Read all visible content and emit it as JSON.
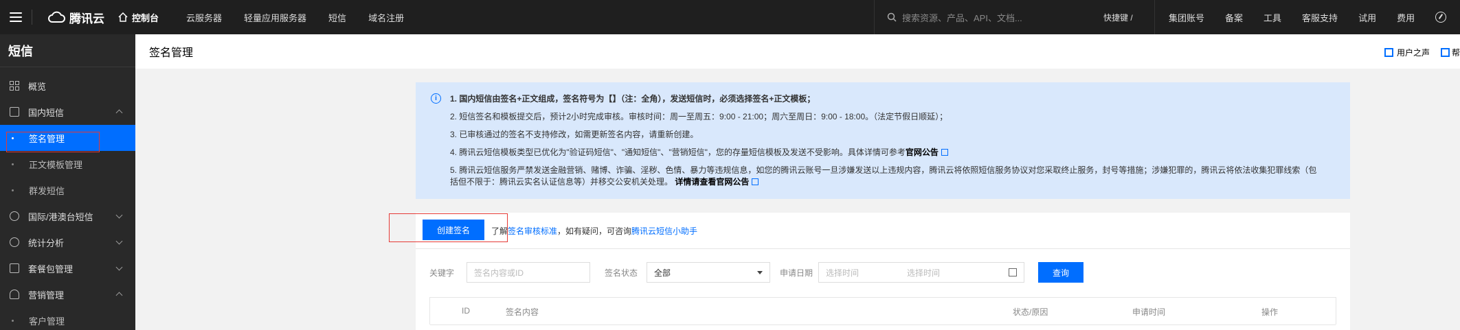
{
  "topbar": {
    "brand": "腾讯云",
    "console": "控制台",
    "nav": [
      "云服务器",
      "轻量应用服务器",
      "短信",
      "域名注册"
    ],
    "search_placeholder": "搜索资源、产品、API、文档...",
    "shortcut": "快捷键 /",
    "right_nav": [
      "集团账号",
      "备案",
      "工具",
      "客服支持",
      "试用",
      "费用"
    ]
  },
  "sidebar": {
    "title": "短信",
    "items": [
      {
        "label": "概览"
      },
      {
        "label": "国内短信"
      },
      {
        "label": "签名管理"
      },
      {
        "label": "正文模板管理"
      },
      {
        "label": "群发短信"
      },
      {
        "label": "国际/港澳台短信"
      },
      {
        "label": "统计分析"
      },
      {
        "label": "套餐包管理"
      },
      {
        "label": "营销管理"
      },
      {
        "label": "客户管理"
      }
    ]
  },
  "header": {
    "title": "签名管理",
    "user_voice": "用户之声",
    "doc": "帮"
  },
  "notice": {
    "items": [
      "1. 国内短信由签名+正文组成，签名符号为【】（注：全角），发送短信时，必须选择签名+正文模板；",
      "2. 短信签名和模板提交后，预计2小时完成审核。审核时间：周一至周五：9:00 - 21:00；周六至周日：9:00 - 18:00。（法定节假日顺延）；",
      "3. 已审核通过的签名不支持修改，如需更新签名内容，请重新创建。",
      "4. 腾讯云短信模板类型已优化为\"验证码短信\"、\"通知短信\"、\"营销短信\"，您的存量短信模板及发送不受影响。具体详情可参考",
      "5. 腾讯云短信服务严禁发送金融营销、赌博、诈骗、淫秽、色情、暴力等违规信息，如您的腾讯云账号一旦涉嫌发送以上违规内容，腾讯云将依照短信服务协议对您采取终止服务，封号等措施；涉嫌犯罪的，腾讯云将依法收集犯罪线索（包",
      "括但不限于：腾讯云实名认证信息等）并移交公安机关处理。"
    ],
    "link_official": "官网公告",
    "link_detail": "详情请查看官网公告"
  },
  "panel": {
    "create_button": "创建签名",
    "hint_prefix": "了解",
    "hint_link1": "签名审核标准",
    "hint_mid": "，如有疑问，可咨询",
    "hint_link2": "腾讯云短信小助手",
    "filter": {
      "keyword_label": "关键字",
      "keyword_placeholder": "签名内容或ID",
      "status_label": "签名状态",
      "status_value": "全部",
      "date_label": "申请日期",
      "date_start_placeholder": "选择时间",
      "date_end_placeholder": "选择时间",
      "query_button": "查询"
    },
    "columns": [
      "ID",
      "签名内容",
      "状态/原因",
      "申请时间",
      "操作"
    ]
  },
  "colors": {
    "accent": "#006eff",
    "highlight": "#e53935"
  }
}
